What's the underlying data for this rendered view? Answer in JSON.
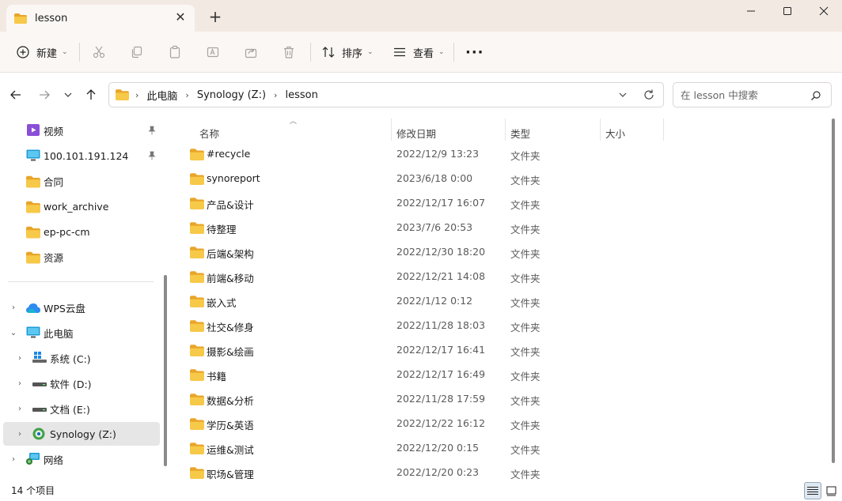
{
  "window": {
    "tab_title": "lesson",
    "tab_close": "✕",
    "new_tab": "+",
    "minimize": "–",
    "maximize": "☐",
    "close": "✕"
  },
  "toolbar": {
    "new_label": "新建",
    "sort_label": "排序",
    "view_label": "查看",
    "more_label": "···"
  },
  "address": {
    "segments": [
      "此电脑",
      "Synology (Z:)",
      "lesson"
    ]
  },
  "search": {
    "placeholder": "在 lesson 中搜索"
  },
  "sidebar": {
    "quick_access": [
      {
        "label": "视频",
        "icon": "video-folder-icon",
        "pinned": true
      },
      {
        "label": "100.101.191.124",
        "icon": "monitor-icon",
        "pinned": true
      },
      {
        "label": "合同",
        "icon": "folder-icon",
        "pinned": false
      },
      {
        "label": "work_archive",
        "icon": "folder-icon",
        "pinned": false
      },
      {
        "label": "ep-pc-cm",
        "icon": "folder-icon",
        "pinned": false
      },
      {
        "label": "资源",
        "icon": "folder-icon",
        "pinned": false
      }
    ],
    "tree": [
      {
        "label": "WPS云盘",
        "icon": "cloud-icon",
        "expanded": false,
        "selected": false
      },
      {
        "label": "此电脑",
        "icon": "pc-icon",
        "expanded": true,
        "selected": false
      },
      {
        "label": "系统 (C:)",
        "icon": "windows-drive-icon",
        "expanded": false,
        "selected": false
      },
      {
        "label": "软件 (D:)",
        "icon": "drive-icon",
        "expanded": false,
        "selected": false
      },
      {
        "label": "文档 (E:)",
        "icon": "drive-icon",
        "expanded": false,
        "selected": false
      },
      {
        "label": "Synology (Z:)",
        "icon": "network-drive-icon",
        "expanded": false,
        "selected": true
      },
      {
        "label": "网络",
        "icon": "network-icon",
        "expanded": false,
        "selected": false
      }
    ]
  },
  "columns": {
    "name": "名称",
    "modified": "修改日期",
    "type": "类型",
    "size": "大小"
  },
  "files": [
    {
      "name": "#recycle",
      "modified": "2022/12/9 13:23",
      "type": "文件夹"
    },
    {
      "name": "synoreport",
      "modified": "2023/6/18 0:00",
      "type": "文件夹"
    },
    {
      "name": "产品&设计",
      "modified": "2022/12/17 16:07",
      "type": "文件夹"
    },
    {
      "name": "待整理",
      "modified": "2023/7/6 20:53",
      "type": "文件夹"
    },
    {
      "name": "后端&架构",
      "modified": "2022/12/30 18:20",
      "type": "文件夹"
    },
    {
      "name": "前端&移动",
      "modified": "2022/12/21 14:08",
      "type": "文件夹"
    },
    {
      "name": "嵌入式",
      "modified": "2022/1/12 0:12",
      "type": "文件夹"
    },
    {
      "name": "社交&修身",
      "modified": "2022/11/28 18:03",
      "type": "文件夹"
    },
    {
      "name": "摄影&绘画",
      "modified": "2022/12/17 16:41",
      "type": "文件夹"
    },
    {
      "name": "书籍",
      "modified": "2022/12/17 16:49",
      "type": "文件夹"
    },
    {
      "name": "数据&分析",
      "modified": "2022/11/28 17:59",
      "type": "文件夹"
    },
    {
      "name": "学历&英语",
      "modified": "2022/12/22 16:12",
      "type": "文件夹"
    },
    {
      "name": "运维&测试",
      "modified": "2022/12/20 0:15",
      "type": "文件夹"
    },
    {
      "name": "职场&管理",
      "modified": "2022/12/20 0:23",
      "type": "文件夹"
    }
  ],
  "status": {
    "item_count": "14 个项目"
  },
  "colors": {
    "titlebar_bg": "#f3e9e3",
    "folder_yellow": "#f6c443",
    "selection_bg": "#e6e6e6"
  }
}
